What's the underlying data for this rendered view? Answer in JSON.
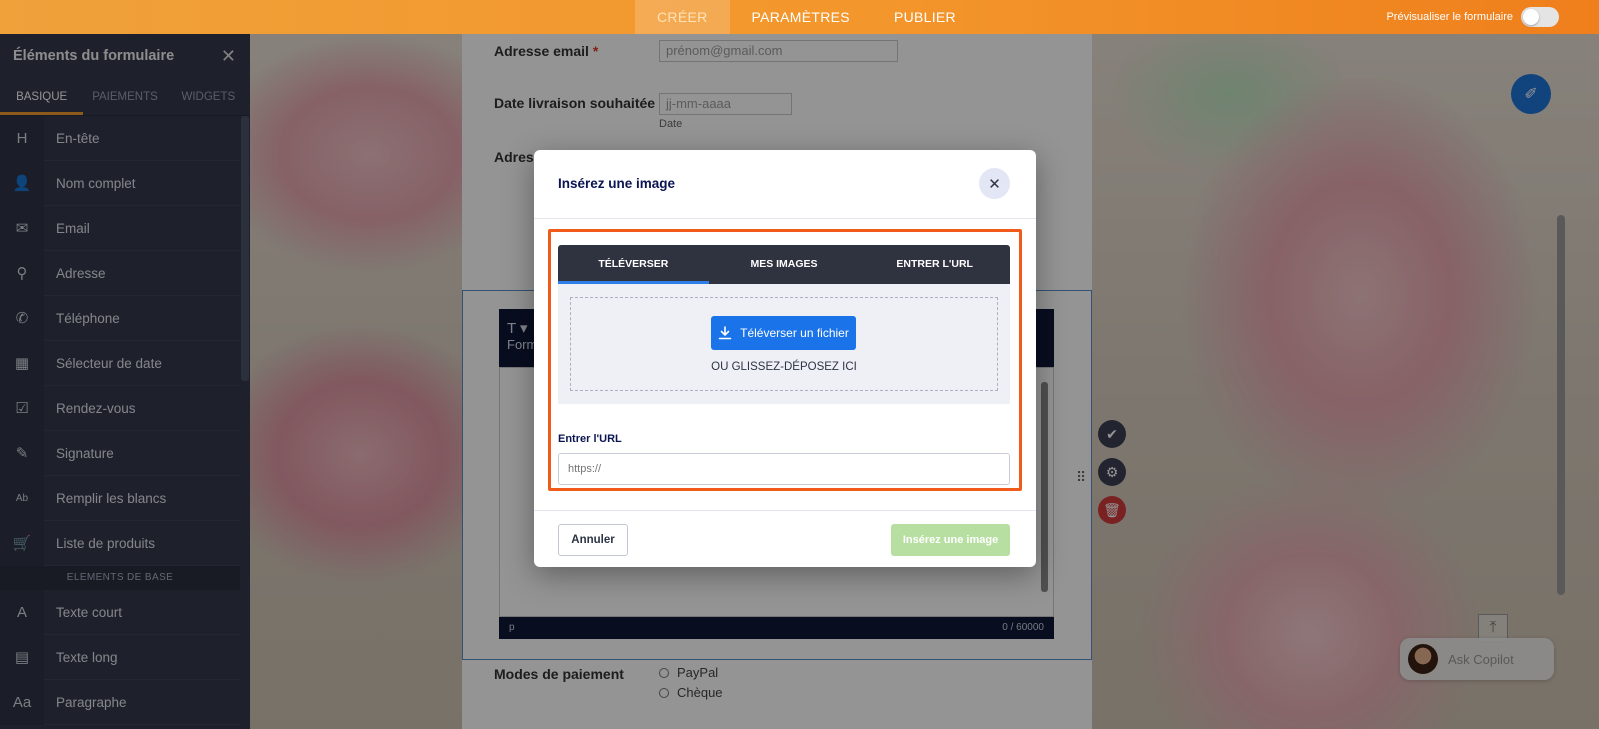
{
  "topbar": {
    "tabs": [
      {
        "label": "CRÉER",
        "active": true
      },
      {
        "label": "PARAMÈTRES",
        "active": false
      },
      {
        "label": "PUBLIER",
        "active": false
      }
    ],
    "preview_label": "Prévisualiser le formulaire"
  },
  "sidebar": {
    "title": "Éléments du formulaire",
    "tabs": [
      {
        "label": "BASIQUE",
        "active": true
      },
      {
        "label": "PAIEMENTS",
        "active": false
      },
      {
        "label": "WIDGETS",
        "active": false
      }
    ],
    "items": [
      {
        "icon": "heading-icon",
        "glyph": "H",
        "label": "En-tête"
      },
      {
        "icon": "person-icon",
        "glyph": "👤",
        "label": "Nom complet"
      },
      {
        "icon": "envelope-icon",
        "glyph": "✉",
        "label": "Email"
      },
      {
        "icon": "location-pin-icon",
        "glyph": "⚲",
        "label": "Adresse"
      },
      {
        "icon": "phone-icon",
        "glyph": "✆",
        "label": "Téléphone"
      },
      {
        "icon": "calendar-icon",
        "glyph": "▦",
        "label": "Sélecteur de date"
      },
      {
        "icon": "calendar-check-icon",
        "glyph": "☑",
        "label": "Rendez-vous"
      },
      {
        "icon": "pen-icon",
        "glyph": "✎",
        "label": "Signature"
      },
      {
        "icon": "fill-blank-icon",
        "glyph": "Ab",
        "label": "Remplir les blancs"
      },
      {
        "icon": "cart-icon",
        "glyph": "🛒",
        "label": "Liste de produits"
      }
    ],
    "section": "ELEMENTS DE BASE",
    "items2": [
      {
        "icon": "short-text-icon",
        "glyph": "A",
        "label": "Texte court"
      },
      {
        "icon": "long-text-icon",
        "glyph": "▤",
        "label": "Texte long"
      },
      {
        "icon": "paragraph-icon",
        "glyph": "Aa",
        "label": "Paragraphe"
      }
    ]
  },
  "form": {
    "email_label": "Adresse email",
    "email_placeholder": "prénom@gmail.com",
    "date_label": "Date livraison souhaitée",
    "date_placeholder": "jj-mm-aaaa",
    "date_sub": "Date",
    "address_label": "Adress",
    "editor_head": "Form",
    "editor_tag": "p",
    "editor_count": "0 / 60000",
    "payment_label": "Modes de paiement",
    "payment_options": [
      "PayPal",
      "Chèque"
    ]
  },
  "copilot": {
    "label": "Ask Copilot"
  },
  "modal": {
    "title": "Insérez une image",
    "tabs": [
      {
        "label": "TÉLÉVERSER",
        "active": true
      },
      {
        "label": "MES IMAGES",
        "active": false
      },
      {
        "label": "ENTRER L'URL",
        "active": false
      }
    ],
    "upload_button": "Téléverser un fichier",
    "drop_text": "OU GLISSEZ-DÉPOSEZ ICI",
    "url_label": "Entrer l'URL",
    "url_placeholder": "https://",
    "cancel": "Annuler",
    "insert": "Insérez une image"
  },
  "colors": {
    "accent": "#f3962b",
    "sidebar_bg": "#343a4d",
    "primary_button": "#1a73e8",
    "highlight": "#f05a1a",
    "insert_disabled": "#b7dfa2"
  }
}
